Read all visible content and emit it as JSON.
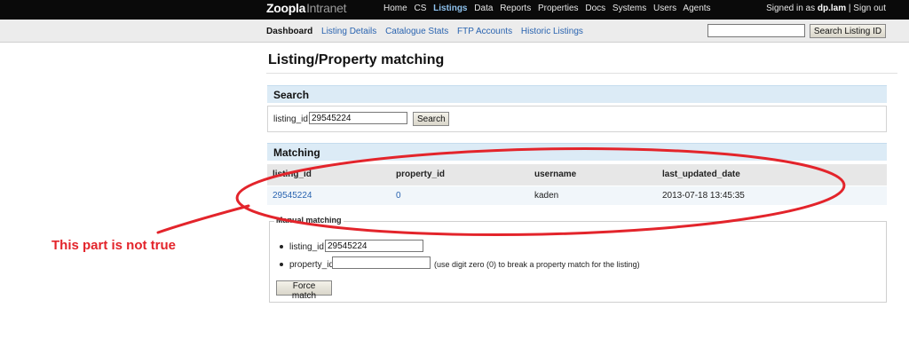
{
  "app": {
    "logo_main": "Zoopla",
    "logo_sub": "Intranet"
  },
  "top_nav": [
    {
      "label": "Home"
    },
    {
      "label": "CS"
    },
    {
      "label": "Listings",
      "active": true
    },
    {
      "label": "Data"
    },
    {
      "label": "Reports"
    },
    {
      "label": "Properties"
    },
    {
      "label": "Docs"
    },
    {
      "label": "Systems"
    },
    {
      "label": "Users"
    },
    {
      "label": "Agents"
    }
  ],
  "account": {
    "signed_in_prefix": "Signed in as",
    "username": "dp.lam",
    "separator": "|",
    "sign_out": "Sign out"
  },
  "sub_nav": [
    {
      "label": "Dashboard",
      "active": true
    },
    {
      "label": "Listing Details"
    },
    {
      "label": "Catalogue Stats"
    },
    {
      "label": "FTP Accounts"
    },
    {
      "label": "Historic Listings"
    }
  ],
  "listing_search": {
    "value": "",
    "button": "Search Listing ID"
  },
  "page": {
    "title": "Listing/Property matching"
  },
  "search_panel": {
    "heading": "Search",
    "field_label": "listing_id",
    "field_value": "29545224",
    "button": "Search"
  },
  "matching_panel": {
    "heading": "Matching",
    "columns": [
      "listing_id",
      "property_id",
      "username",
      "last_updated_date"
    ],
    "rows": [
      [
        "29545224",
        "0",
        "kaden",
        "2013-07-18 13:45:35"
      ]
    ]
  },
  "manual_matching": {
    "legend": "Manual matching",
    "listing_id_label": "listing_id",
    "listing_id_value": "29545224",
    "property_id_label": "property_id",
    "property_id_value": "",
    "hint": "(use digit zero (0) to break a property match for the listing)",
    "button": "Force match"
  },
  "annotation": {
    "text": "This part is not true",
    "color": "#e3242b"
  },
  "colors": {
    "topbar": "#0a0a0a",
    "active_nav": "#8ec2ee",
    "link": "#2a64b0",
    "panel_head": "#dcebf6"
  }
}
